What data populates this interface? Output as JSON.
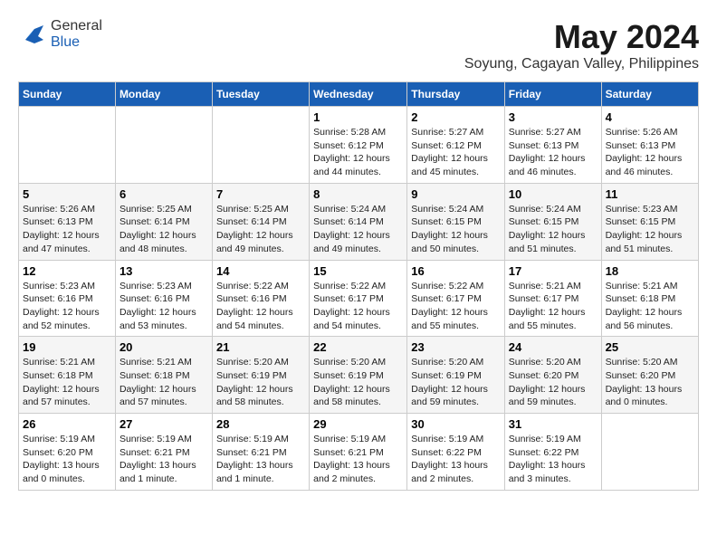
{
  "header": {
    "logo_general": "General",
    "logo_blue": "Blue",
    "month_title": "May 2024",
    "location": "Soyung, Cagayan Valley, Philippines"
  },
  "weekdays": [
    "Sunday",
    "Monday",
    "Tuesday",
    "Wednesday",
    "Thursday",
    "Friday",
    "Saturday"
  ],
  "weeks": [
    [
      {
        "day": "",
        "info": ""
      },
      {
        "day": "",
        "info": ""
      },
      {
        "day": "",
        "info": ""
      },
      {
        "day": "1",
        "info": "Sunrise: 5:28 AM\nSunset: 6:12 PM\nDaylight: 12 hours\nand 44 minutes."
      },
      {
        "day": "2",
        "info": "Sunrise: 5:27 AM\nSunset: 6:12 PM\nDaylight: 12 hours\nand 45 minutes."
      },
      {
        "day": "3",
        "info": "Sunrise: 5:27 AM\nSunset: 6:13 PM\nDaylight: 12 hours\nand 46 minutes."
      },
      {
        "day": "4",
        "info": "Sunrise: 5:26 AM\nSunset: 6:13 PM\nDaylight: 12 hours\nand 46 minutes."
      }
    ],
    [
      {
        "day": "5",
        "info": "Sunrise: 5:26 AM\nSunset: 6:13 PM\nDaylight: 12 hours\nand 47 minutes."
      },
      {
        "day": "6",
        "info": "Sunrise: 5:25 AM\nSunset: 6:14 PM\nDaylight: 12 hours\nand 48 minutes."
      },
      {
        "day": "7",
        "info": "Sunrise: 5:25 AM\nSunset: 6:14 PM\nDaylight: 12 hours\nand 49 minutes."
      },
      {
        "day": "8",
        "info": "Sunrise: 5:24 AM\nSunset: 6:14 PM\nDaylight: 12 hours\nand 49 minutes."
      },
      {
        "day": "9",
        "info": "Sunrise: 5:24 AM\nSunset: 6:15 PM\nDaylight: 12 hours\nand 50 minutes."
      },
      {
        "day": "10",
        "info": "Sunrise: 5:24 AM\nSunset: 6:15 PM\nDaylight: 12 hours\nand 51 minutes."
      },
      {
        "day": "11",
        "info": "Sunrise: 5:23 AM\nSunset: 6:15 PM\nDaylight: 12 hours\nand 51 minutes."
      }
    ],
    [
      {
        "day": "12",
        "info": "Sunrise: 5:23 AM\nSunset: 6:16 PM\nDaylight: 12 hours\nand 52 minutes."
      },
      {
        "day": "13",
        "info": "Sunrise: 5:23 AM\nSunset: 6:16 PM\nDaylight: 12 hours\nand 53 minutes."
      },
      {
        "day": "14",
        "info": "Sunrise: 5:22 AM\nSunset: 6:16 PM\nDaylight: 12 hours\nand 54 minutes."
      },
      {
        "day": "15",
        "info": "Sunrise: 5:22 AM\nSunset: 6:17 PM\nDaylight: 12 hours\nand 54 minutes."
      },
      {
        "day": "16",
        "info": "Sunrise: 5:22 AM\nSunset: 6:17 PM\nDaylight: 12 hours\nand 55 minutes."
      },
      {
        "day": "17",
        "info": "Sunrise: 5:21 AM\nSunset: 6:17 PM\nDaylight: 12 hours\nand 55 minutes."
      },
      {
        "day": "18",
        "info": "Sunrise: 5:21 AM\nSunset: 6:18 PM\nDaylight: 12 hours\nand 56 minutes."
      }
    ],
    [
      {
        "day": "19",
        "info": "Sunrise: 5:21 AM\nSunset: 6:18 PM\nDaylight: 12 hours\nand 57 minutes."
      },
      {
        "day": "20",
        "info": "Sunrise: 5:21 AM\nSunset: 6:18 PM\nDaylight: 12 hours\nand 57 minutes."
      },
      {
        "day": "21",
        "info": "Sunrise: 5:20 AM\nSunset: 6:19 PM\nDaylight: 12 hours\nand 58 minutes."
      },
      {
        "day": "22",
        "info": "Sunrise: 5:20 AM\nSunset: 6:19 PM\nDaylight: 12 hours\nand 58 minutes."
      },
      {
        "day": "23",
        "info": "Sunrise: 5:20 AM\nSunset: 6:19 PM\nDaylight: 12 hours\nand 59 minutes."
      },
      {
        "day": "24",
        "info": "Sunrise: 5:20 AM\nSunset: 6:20 PM\nDaylight: 12 hours\nand 59 minutes."
      },
      {
        "day": "25",
        "info": "Sunrise: 5:20 AM\nSunset: 6:20 PM\nDaylight: 13 hours\nand 0 minutes."
      }
    ],
    [
      {
        "day": "26",
        "info": "Sunrise: 5:19 AM\nSunset: 6:20 PM\nDaylight: 13 hours\nand 0 minutes."
      },
      {
        "day": "27",
        "info": "Sunrise: 5:19 AM\nSunset: 6:21 PM\nDaylight: 13 hours\nand 1 minute."
      },
      {
        "day": "28",
        "info": "Sunrise: 5:19 AM\nSunset: 6:21 PM\nDaylight: 13 hours\nand 1 minute."
      },
      {
        "day": "29",
        "info": "Sunrise: 5:19 AM\nSunset: 6:21 PM\nDaylight: 13 hours\nand 2 minutes."
      },
      {
        "day": "30",
        "info": "Sunrise: 5:19 AM\nSunset: 6:22 PM\nDaylight: 13 hours\nand 2 minutes."
      },
      {
        "day": "31",
        "info": "Sunrise: 5:19 AM\nSunset: 6:22 PM\nDaylight: 13 hours\nand 3 minutes."
      },
      {
        "day": "",
        "info": ""
      }
    ]
  ]
}
